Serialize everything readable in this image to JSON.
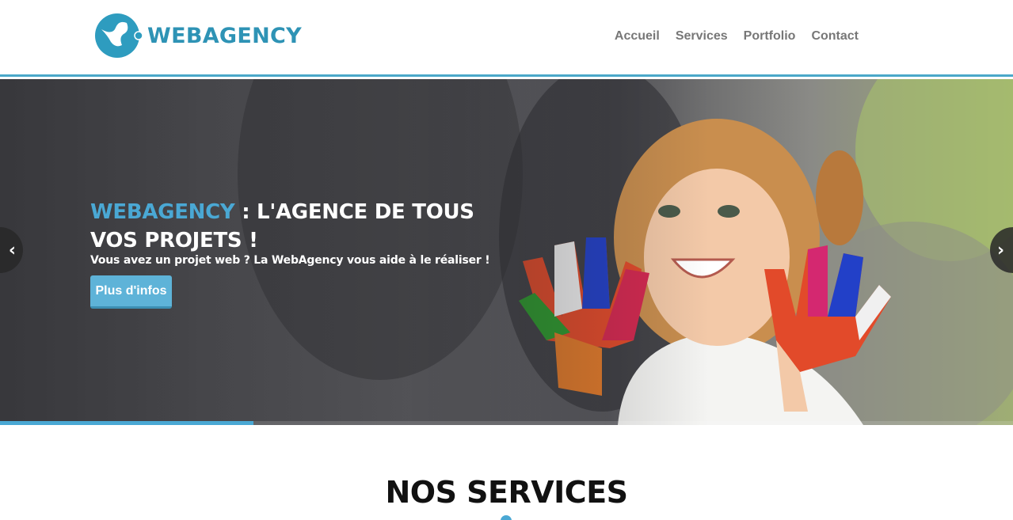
{
  "brand": {
    "name": "WEBAGENCY",
    "color": "#2e93b5",
    "logo_icon": "webagency-logo-icon"
  },
  "nav": {
    "items": [
      "Accueil",
      "Services",
      "Portfolio",
      "Contact"
    ]
  },
  "hero": {
    "title_accent": "WEBAGENCY",
    "title_rest": " : L'AGENCE DE TOUS VOS PROJETS !",
    "subtitle": "Vous avez un projet web ? La WebAgency vous aide à le réaliser !",
    "button_label": "Plus d'infos",
    "prev_icon": "chevron-left-icon",
    "next_icon": "chevron-right-icon",
    "slide_progress": 0.25,
    "image": "child-with-painted-hands-photo"
  },
  "services": {
    "title": "NOS SERVICES"
  },
  "colors": {
    "accent": "#4aa8d4",
    "nav_text": "#777777"
  }
}
